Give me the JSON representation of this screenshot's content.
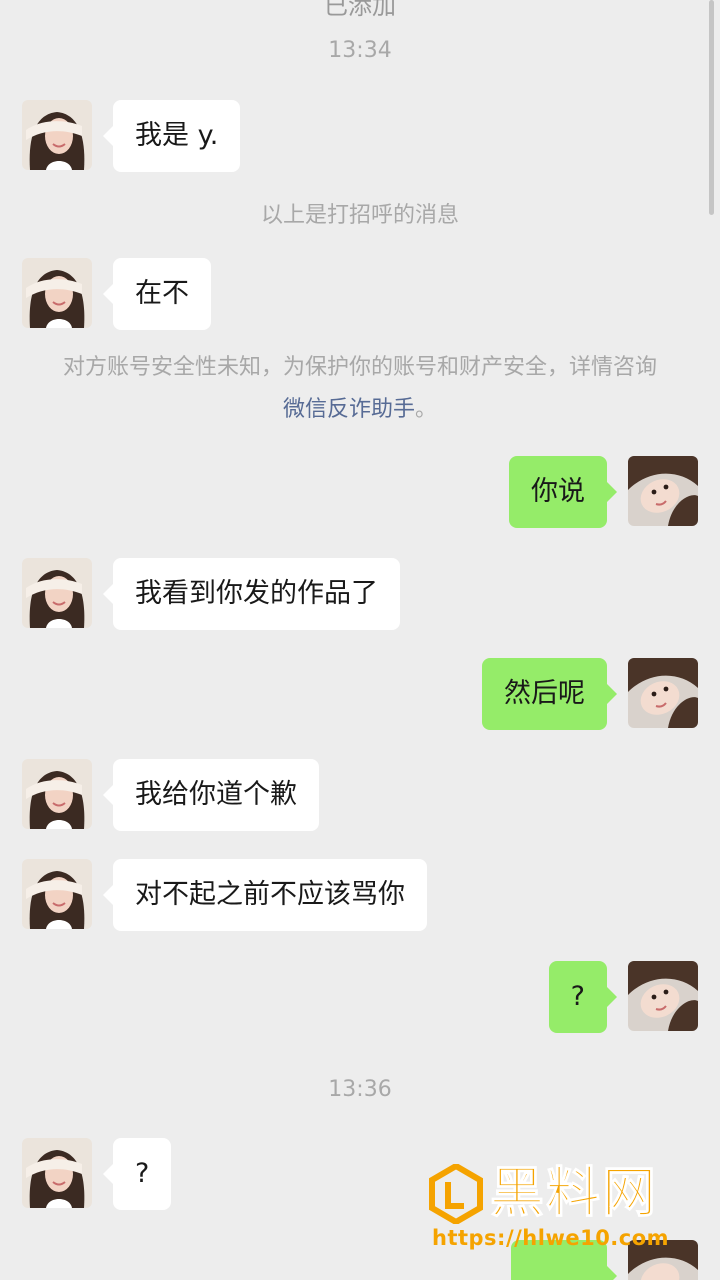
{
  "top_cut_text": "已添加",
  "timestamps": [
    "13:34",
    "13:36"
  ],
  "greeting_notice": "以上是打招呼的消息",
  "security_notice": {
    "text": "对方账号安全性未知，为保护你的账号和财产安全，详情咨询",
    "link": "微信反诈助手",
    "end": "。"
  },
  "messages": [
    {
      "side": "in",
      "text": "我是 y."
    },
    {
      "side": "in",
      "text": "在不"
    },
    {
      "side": "out",
      "text": "你说"
    },
    {
      "side": "in",
      "text": "我看到你发的作品了"
    },
    {
      "side": "out",
      "text": "然后呢"
    },
    {
      "side": "in",
      "text": "我给你道个歉"
    },
    {
      "side": "in",
      "text": "对不起之前不应该骂你"
    },
    {
      "side": "out",
      "text": "?"
    },
    {
      "side": "in",
      "text": "?"
    }
  ],
  "watermark": {
    "title": "黑料网",
    "url": "https://hlwe10.com"
  },
  "colors": {
    "background": "#ededed",
    "incoming_bubble": "#ffffff",
    "outgoing_bubble": "#95ec69",
    "link": "#576b95",
    "watermark": "#f5a300"
  }
}
